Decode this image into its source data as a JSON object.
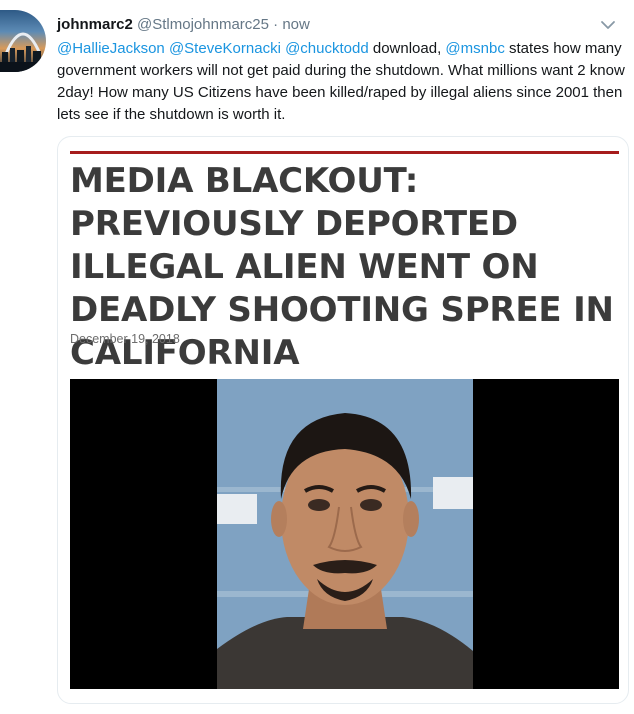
{
  "tweet": {
    "display_name": "johnmarc2",
    "handle": "@Stlmojohnmarc25",
    "separator": "·",
    "timestamp": "now",
    "mentions": [
      "@HallieJackson",
      "@SteveKornacki",
      "@chucktodd",
      "@msnbc"
    ],
    "text_part1": " download, ",
    "text_part2": " states how many government workers will not get paid during the shutdown. What millions want 2 know 2day! How many US Citizens have been killed/raped by illegal aliens since 2001 then lets see if the shutdown is worth it."
  },
  "card": {
    "headline": "MEDIA BLACKOUT: PREVIOUSLY DEPORTED ILLEGAL ALIEN WENT ON DEADLY SHOOTING SPREE IN CALIFORNIA",
    "date": "December 19, 2018"
  },
  "icons": {
    "menu": "chevron-down-icon"
  },
  "colors": {
    "link": "#1b95e0",
    "accent_rule": "#a61c1c",
    "secondary_text": "#657786"
  }
}
